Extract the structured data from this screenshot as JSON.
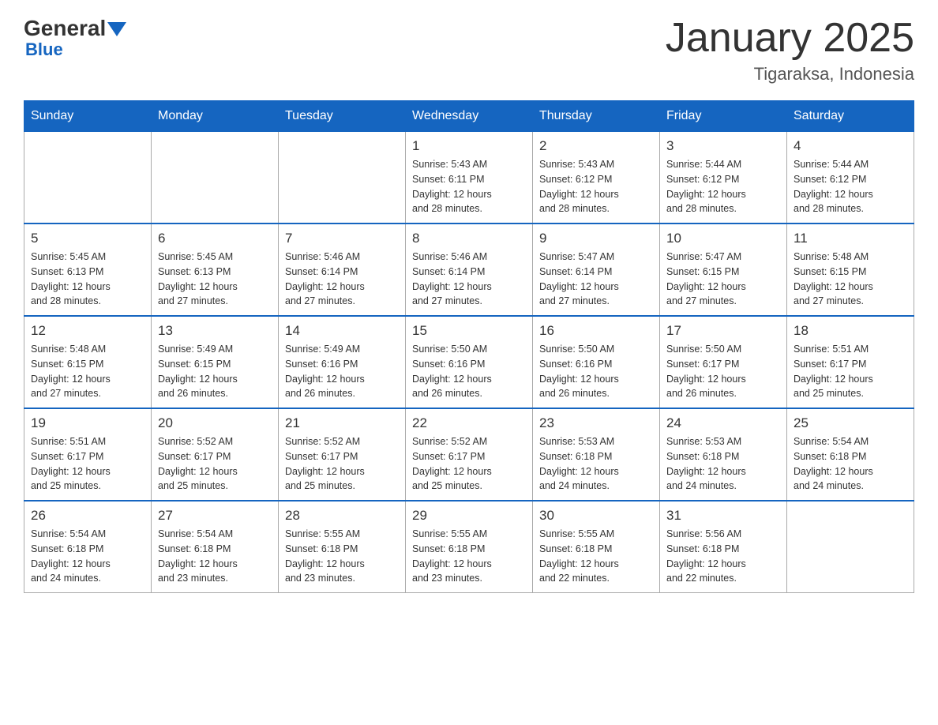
{
  "header": {
    "logo_general": "General",
    "logo_blue": "Blue",
    "month_title": "January 2025",
    "location": "Tigaraksa, Indonesia"
  },
  "days_of_week": [
    "Sunday",
    "Monday",
    "Tuesday",
    "Wednesday",
    "Thursday",
    "Friday",
    "Saturday"
  ],
  "weeks": [
    [
      {
        "day": "",
        "info": ""
      },
      {
        "day": "",
        "info": ""
      },
      {
        "day": "",
        "info": ""
      },
      {
        "day": "1",
        "info": "Sunrise: 5:43 AM\nSunset: 6:11 PM\nDaylight: 12 hours\nand 28 minutes."
      },
      {
        "day": "2",
        "info": "Sunrise: 5:43 AM\nSunset: 6:12 PM\nDaylight: 12 hours\nand 28 minutes."
      },
      {
        "day": "3",
        "info": "Sunrise: 5:44 AM\nSunset: 6:12 PM\nDaylight: 12 hours\nand 28 minutes."
      },
      {
        "day": "4",
        "info": "Sunrise: 5:44 AM\nSunset: 6:12 PM\nDaylight: 12 hours\nand 28 minutes."
      }
    ],
    [
      {
        "day": "5",
        "info": "Sunrise: 5:45 AM\nSunset: 6:13 PM\nDaylight: 12 hours\nand 28 minutes."
      },
      {
        "day": "6",
        "info": "Sunrise: 5:45 AM\nSunset: 6:13 PM\nDaylight: 12 hours\nand 27 minutes."
      },
      {
        "day": "7",
        "info": "Sunrise: 5:46 AM\nSunset: 6:14 PM\nDaylight: 12 hours\nand 27 minutes."
      },
      {
        "day": "8",
        "info": "Sunrise: 5:46 AM\nSunset: 6:14 PM\nDaylight: 12 hours\nand 27 minutes."
      },
      {
        "day": "9",
        "info": "Sunrise: 5:47 AM\nSunset: 6:14 PM\nDaylight: 12 hours\nand 27 minutes."
      },
      {
        "day": "10",
        "info": "Sunrise: 5:47 AM\nSunset: 6:15 PM\nDaylight: 12 hours\nand 27 minutes."
      },
      {
        "day": "11",
        "info": "Sunrise: 5:48 AM\nSunset: 6:15 PM\nDaylight: 12 hours\nand 27 minutes."
      }
    ],
    [
      {
        "day": "12",
        "info": "Sunrise: 5:48 AM\nSunset: 6:15 PM\nDaylight: 12 hours\nand 27 minutes."
      },
      {
        "day": "13",
        "info": "Sunrise: 5:49 AM\nSunset: 6:15 PM\nDaylight: 12 hours\nand 26 minutes."
      },
      {
        "day": "14",
        "info": "Sunrise: 5:49 AM\nSunset: 6:16 PM\nDaylight: 12 hours\nand 26 minutes."
      },
      {
        "day": "15",
        "info": "Sunrise: 5:50 AM\nSunset: 6:16 PM\nDaylight: 12 hours\nand 26 minutes."
      },
      {
        "day": "16",
        "info": "Sunrise: 5:50 AM\nSunset: 6:16 PM\nDaylight: 12 hours\nand 26 minutes."
      },
      {
        "day": "17",
        "info": "Sunrise: 5:50 AM\nSunset: 6:17 PM\nDaylight: 12 hours\nand 26 minutes."
      },
      {
        "day": "18",
        "info": "Sunrise: 5:51 AM\nSunset: 6:17 PM\nDaylight: 12 hours\nand 25 minutes."
      }
    ],
    [
      {
        "day": "19",
        "info": "Sunrise: 5:51 AM\nSunset: 6:17 PM\nDaylight: 12 hours\nand 25 minutes."
      },
      {
        "day": "20",
        "info": "Sunrise: 5:52 AM\nSunset: 6:17 PM\nDaylight: 12 hours\nand 25 minutes."
      },
      {
        "day": "21",
        "info": "Sunrise: 5:52 AM\nSunset: 6:17 PM\nDaylight: 12 hours\nand 25 minutes."
      },
      {
        "day": "22",
        "info": "Sunrise: 5:52 AM\nSunset: 6:17 PM\nDaylight: 12 hours\nand 25 minutes."
      },
      {
        "day": "23",
        "info": "Sunrise: 5:53 AM\nSunset: 6:18 PM\nDaylight: 12 hours\nand 24 minutes."
      },
      {
        "day": "24",
        "info": "Sunrise: 5:53 AM\nSunset: 6:18 PM\nDaylight: 12 hours\nand 24 minutes."
      },
      {
        "day": "25",
        "info": "Sunrise: 5:54 AM\nSunset: 6:18 PM\nDaylight: 12 hours\nand 24 minutes."
      }
    ],
    [
      {
        "day": "26",
        "info": "Sunrise: 5:54 AM\nSunset: 6:18 PM\nDaylight: 12 hours\nand 24 minutes."
      },
      {
        "day": "27",
        "info": "Sunrise: 5:54 AM\nSunset: 6:18 PM\nDaylight: 12 hours\nand 23 minutes."
      },
      {
        "day": "28",
        "info": "Sunrise: 5:55 AM\nSunset: 6:18 PM\nDaylight: 12 hours\nand 23 minutes."
      },
      {
        "day": "29",
        "info": "Sunrise: 5:55 AM\nSunset: 6:18 PM\nDaylight: 12 hours\nand 23 minutes."
      },
      {
        "day": "30",
        "info": "Sunrise: 5:55 AM\nSunset: 6:18 PM\nDaylight: 12 hours\nand 22 minutes."
      },
      {
        "day": "31",
        "info": "Sunrise: 5:56 AM\nSunset: 6:18 PM\nDaylight: 12 hours\nand 22 minutes."
      },
      {
        "day": "",
        "info": ""
      }
    ]
  ]
}
